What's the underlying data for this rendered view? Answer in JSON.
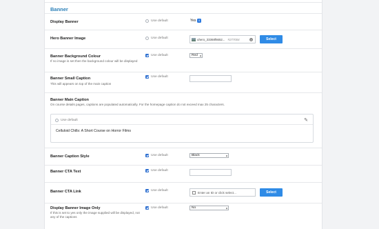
{
  "section_title": "Banner",
  "use_default_label": "Use default",
  "display_banner": {
    "label": "Display Banner",
    "value": "Yes"
  },
  "hero_image": {
    "label": "Hero Banner Image",
    "filename": "uhero_33368f6652...",
    "hint": "#277004",
    "button": "Select"
  },
  "bg_colour": {
    "label": "Banner Background Colour",
    "sub": "If no image is set then the background colour will be displayed",
    "value": "Red"
  },
  "small_caption": {
    "label": "Banner Small Caption",
    "sub": "This will appears on top of the main caption",
    "value": ""
  },
  "main_caption": {
    "label": "Banner Main Caption",
    "sub": "On course details pages, captions are populated automatically. For the homepage caption do not exceed max 25 characters.",
    "value": "Celluloid Chills: A Short Course on Horror Films"
  },
  "caption_style": {
    "label": "Banner Caption Style",
    "value": "Black"
  },
  "cta_text": {
    "label": "Banner CTA Text",
    "value": ""
  },
  "cta_link": {
    "label": "Banner CTA Link",
    "placeholder": "Enter an ID or click select...",
    "button": "Select"
  },
  "image_only": {
    "label": "Display Banner Image Only",
    "sub": "If this is set to yes only the image supplied will be displayed, not any of the captions",
    "value": "No"
  }
}
